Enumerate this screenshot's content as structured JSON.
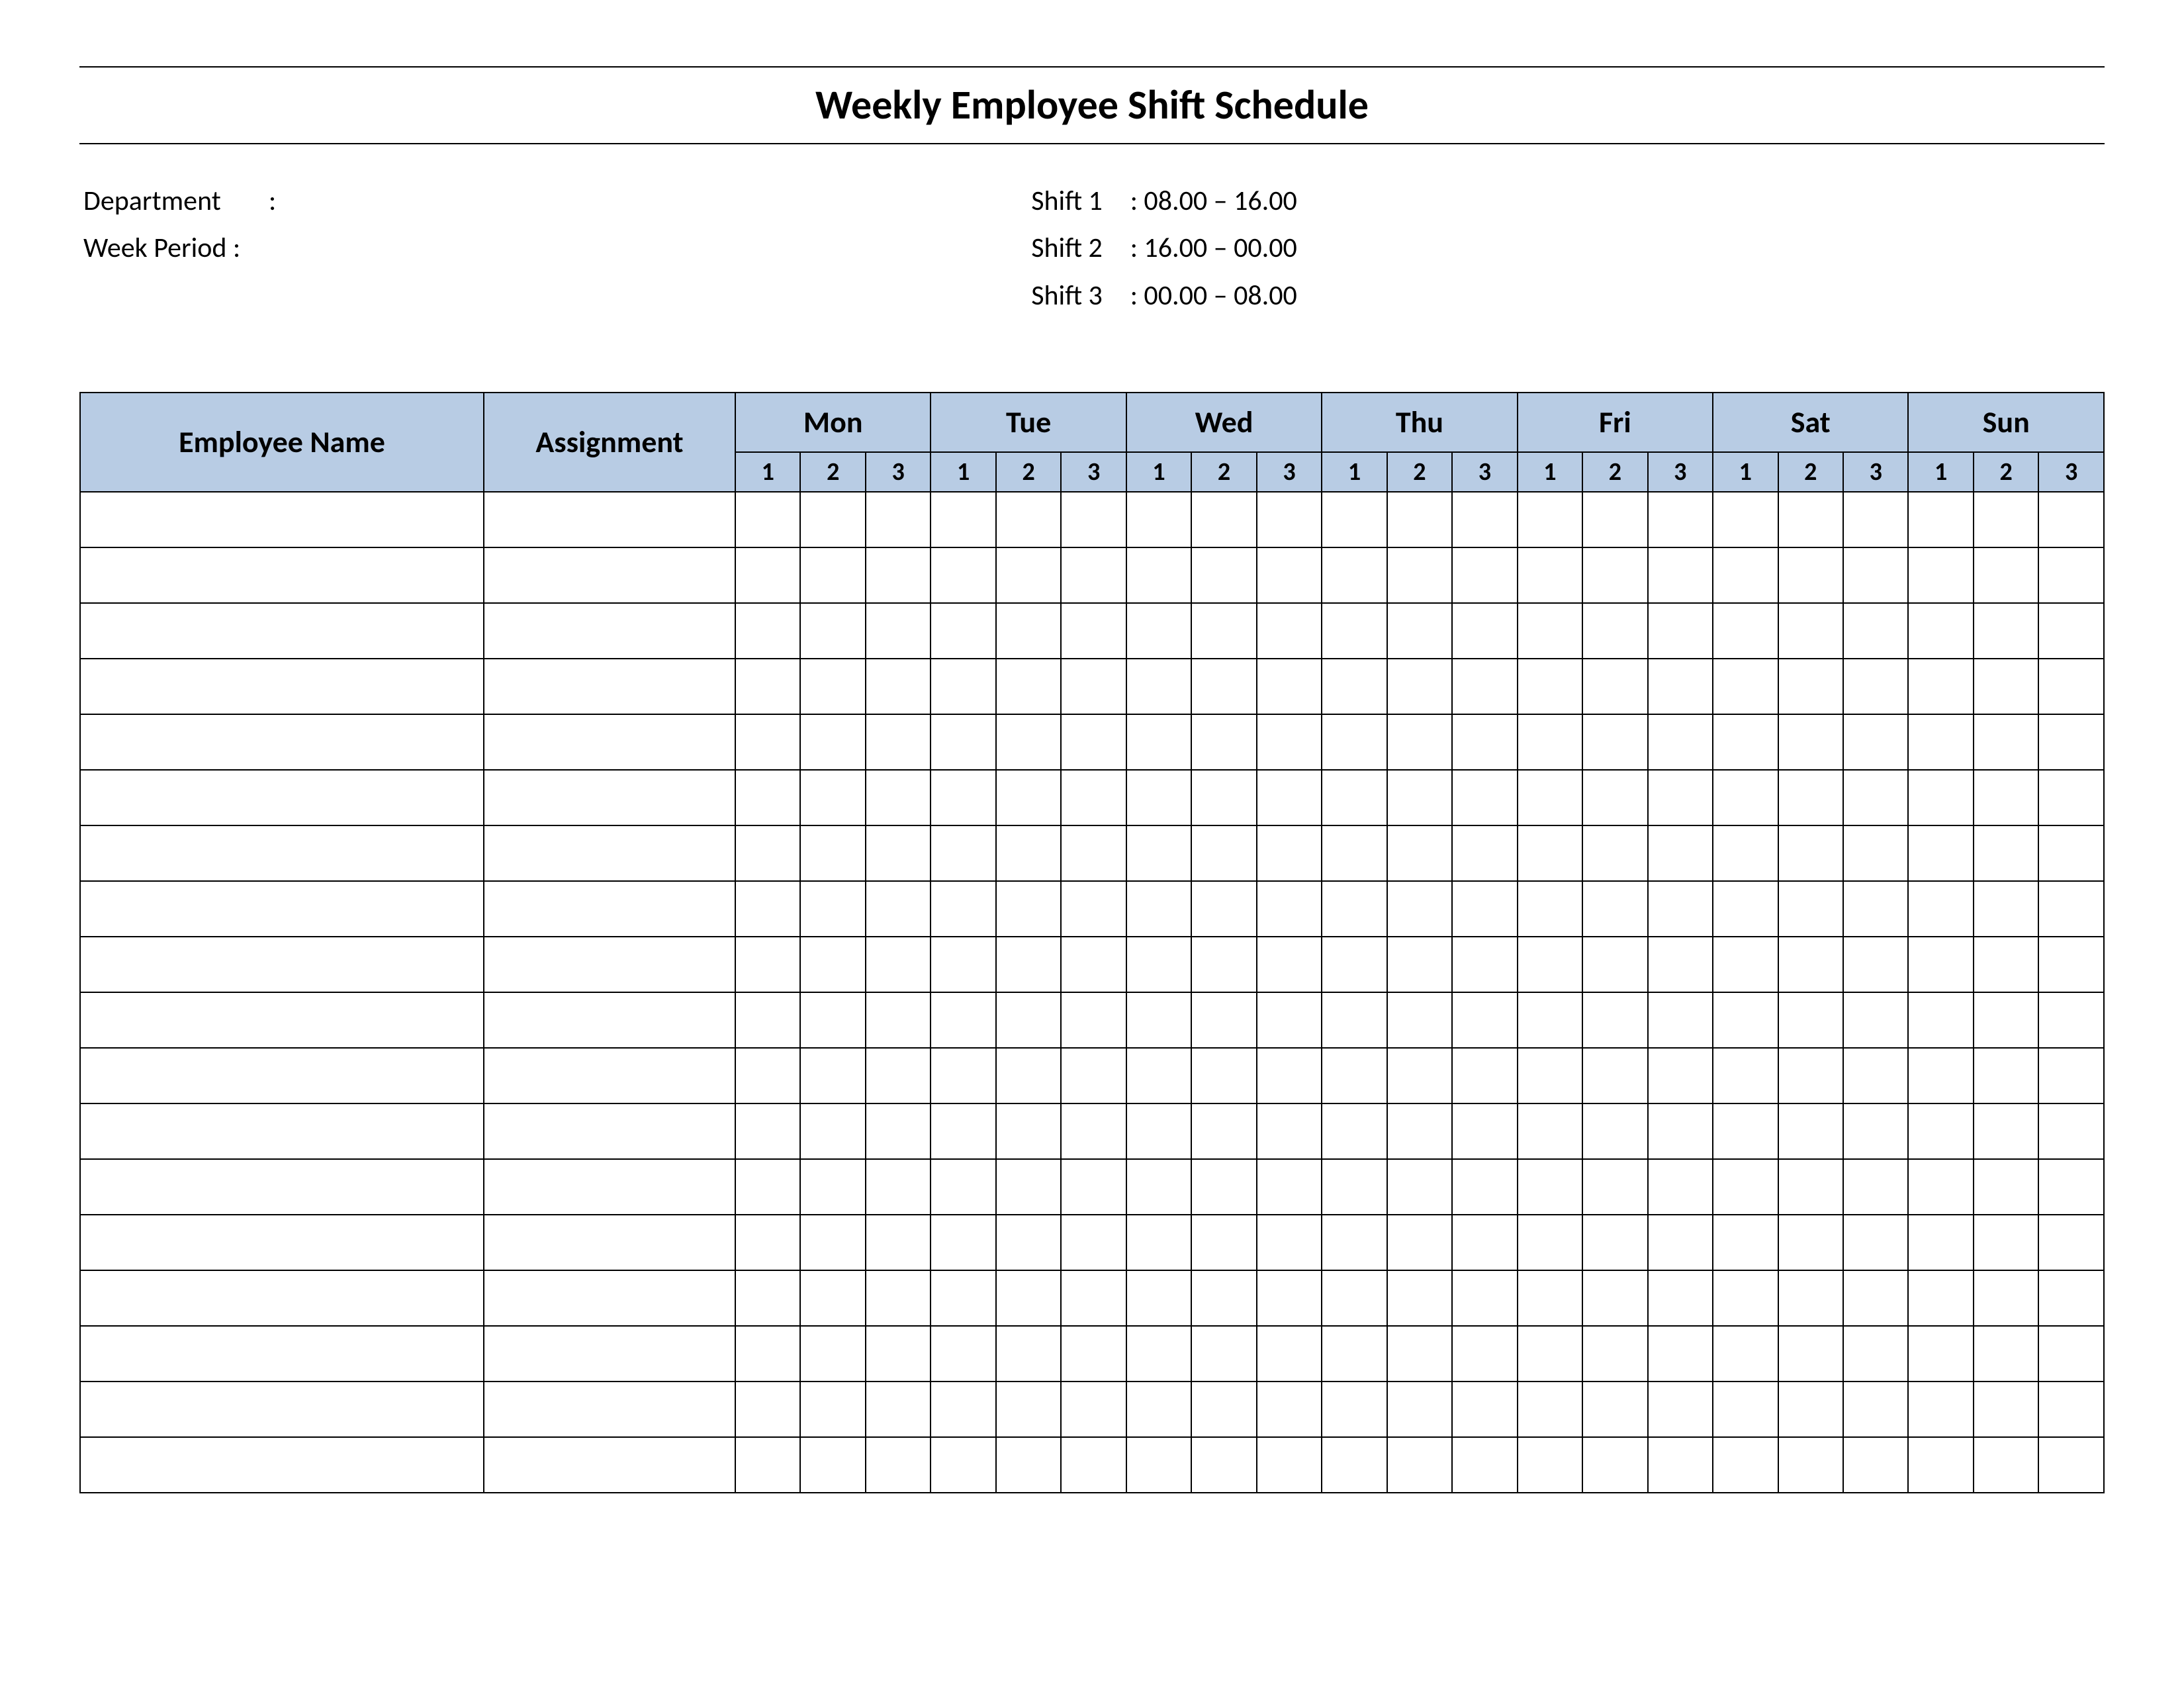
{
  "title": "Weekly Employee Shift Schedule",
  "meta": {
    "department_label": "Department",
    "department_value": "",
    "week_period_label": "Week  Period :",
    "week_period_value": "",
    "shifts": [
      {
        "label": "Shift 1",
        "text": ": 08.00  – 16.00"
      },
      {
        "label": "Shift 2",
        "text": ": 16.00  – 00.00"
      },
      {
        "label": "Shift 3",
        "text": ": 00.00  – 08.00"
      }
    ]
  },
  "headers": {
    "employee_name": "Employee Name",
    "assignment": "Assignment",
    "days": [
      "Mon",
      "Tue",
      "Wed",
      "Thu",
      "Fri",
      "Sat",
      "Sun"
    ],
    "shift_nums": [
      "1",
      "2",
      "3"
    ]
  },
  "row_count": 18
}
